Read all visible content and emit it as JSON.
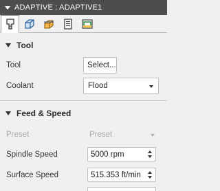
{
  "window": {
    "title": "ADAPTIVE : ADAPTIVE1"
  },
  "tabs": [
    {
      "icon": "tool-icon",
      "active": true
    },
    {
      "icon": "geometry-icon",
      "active": false
    },
    {
      "icon": "heights-icon",
      "active": false
    },
    {
      "icon": "passes-icon",
      "active": false
    },
    {
      "icon": "linking-icon",
      "active": false
    }
  ],
  "tool_section": {
    "title": "Tool",
    "tool_label": "Tool",
    "tool_button": "Select...",
    "coolant_label": "Coolant",
    "coolant_value": "Flood"
  },
  "feed_section": {
    "title": "Feed & Speed",
    "preset_label": "Preset",
    "preset_value": "Preset",
    "spindle_label": "Spindle Speed",
    "spindle_value": "5000 rpm",
    "surface_label": "Surface Speed",
    "surface_value": "515.353 ft/min"
  }
}
